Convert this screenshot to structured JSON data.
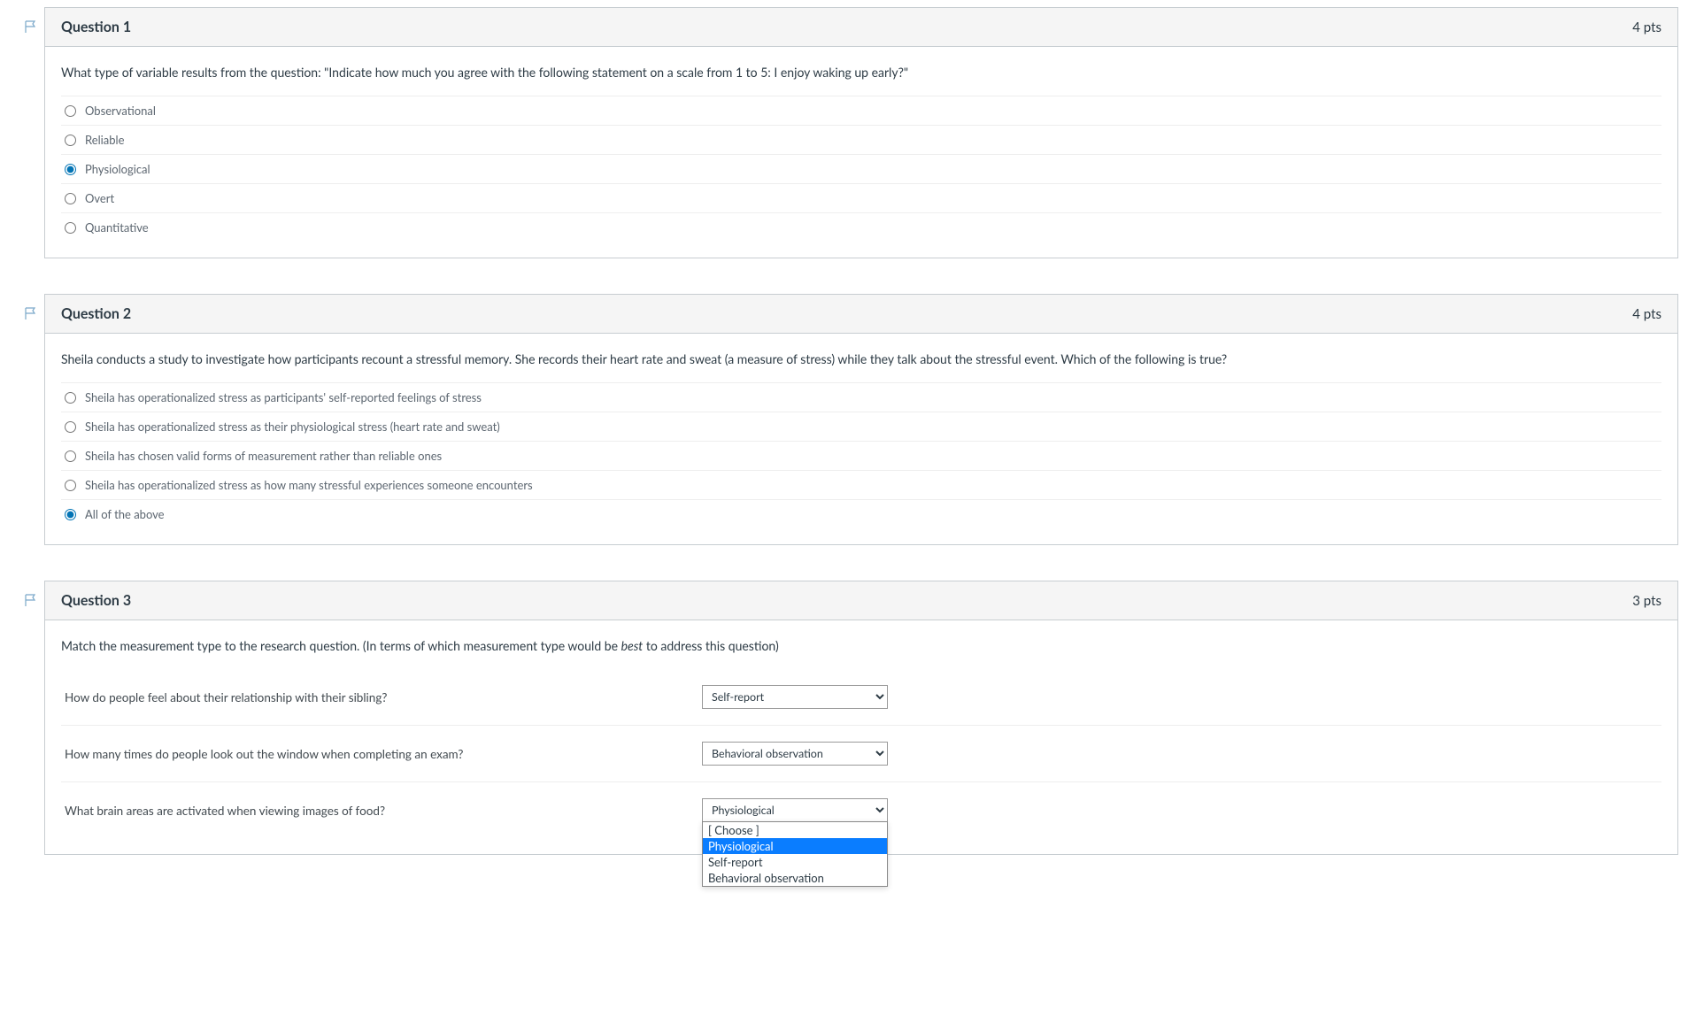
{
  "questions": [
    {
      "title": "Question 1",
      "pts": "4 pts",
      "prompt": "What type of variable results from the question: \"Indicate how much you agree with the following statement on a scale from 1 to 5: I enjoy waking up early?\"",
      "answers": [
        "Observational",
        "Reliable",
        "Physiological",
        "Overt",
        "Quantitative"
      ],
      "selected": 2
    },
    {
      "title": "Question 2",
      "pts": "4 pts",
      "prompt": "Sheila conducts a study to investigate how participants recount a stressful memory. She records their heart rate and sweat (a measure of stress) while they talk about the stressful event. Which of the following is true?",
      "answers": [
        "Sheila has operationalized stress as participants' self-reported feelings of stress",
        "Sheila has operationalized stress as their physiological stress (heart rate and sweat)",
        "Sheila has chosen valid forms of measurement rather than reliable ones",
        "Sheila has operationalized stress as how many stressful experiences someone encounters",
        "All of the above"
      ],
      "selected": 4
    },
    {
      "title": "Question 3",
      "pts": "3 pts",
      "prompt_pre": "Match the measurement type to the research question.  (In terms of which measurement type would be ",
      "prompt_em": "best",
      "prompt_post": " to address this question)",
      "matches": [
        {
          "text": "How do people feel about their relationship with their sibling?",
          "value": "Self-report"
        },
        {
          "text": "How many times do people look out the window when completing an exam?",
          "value": "Behavioral observation"
        },
        {
          "text": "What brain areas are activated when viewing images of food?",
          "value": "Physiological"
        }
      ],
      "dropdown_options": [
        "[ Choose ]",
        "Physiological",
        "Self-report",
        "Behavioral observation"
      ],
      "dropdown_highlight": 1
    }
  ]
}
